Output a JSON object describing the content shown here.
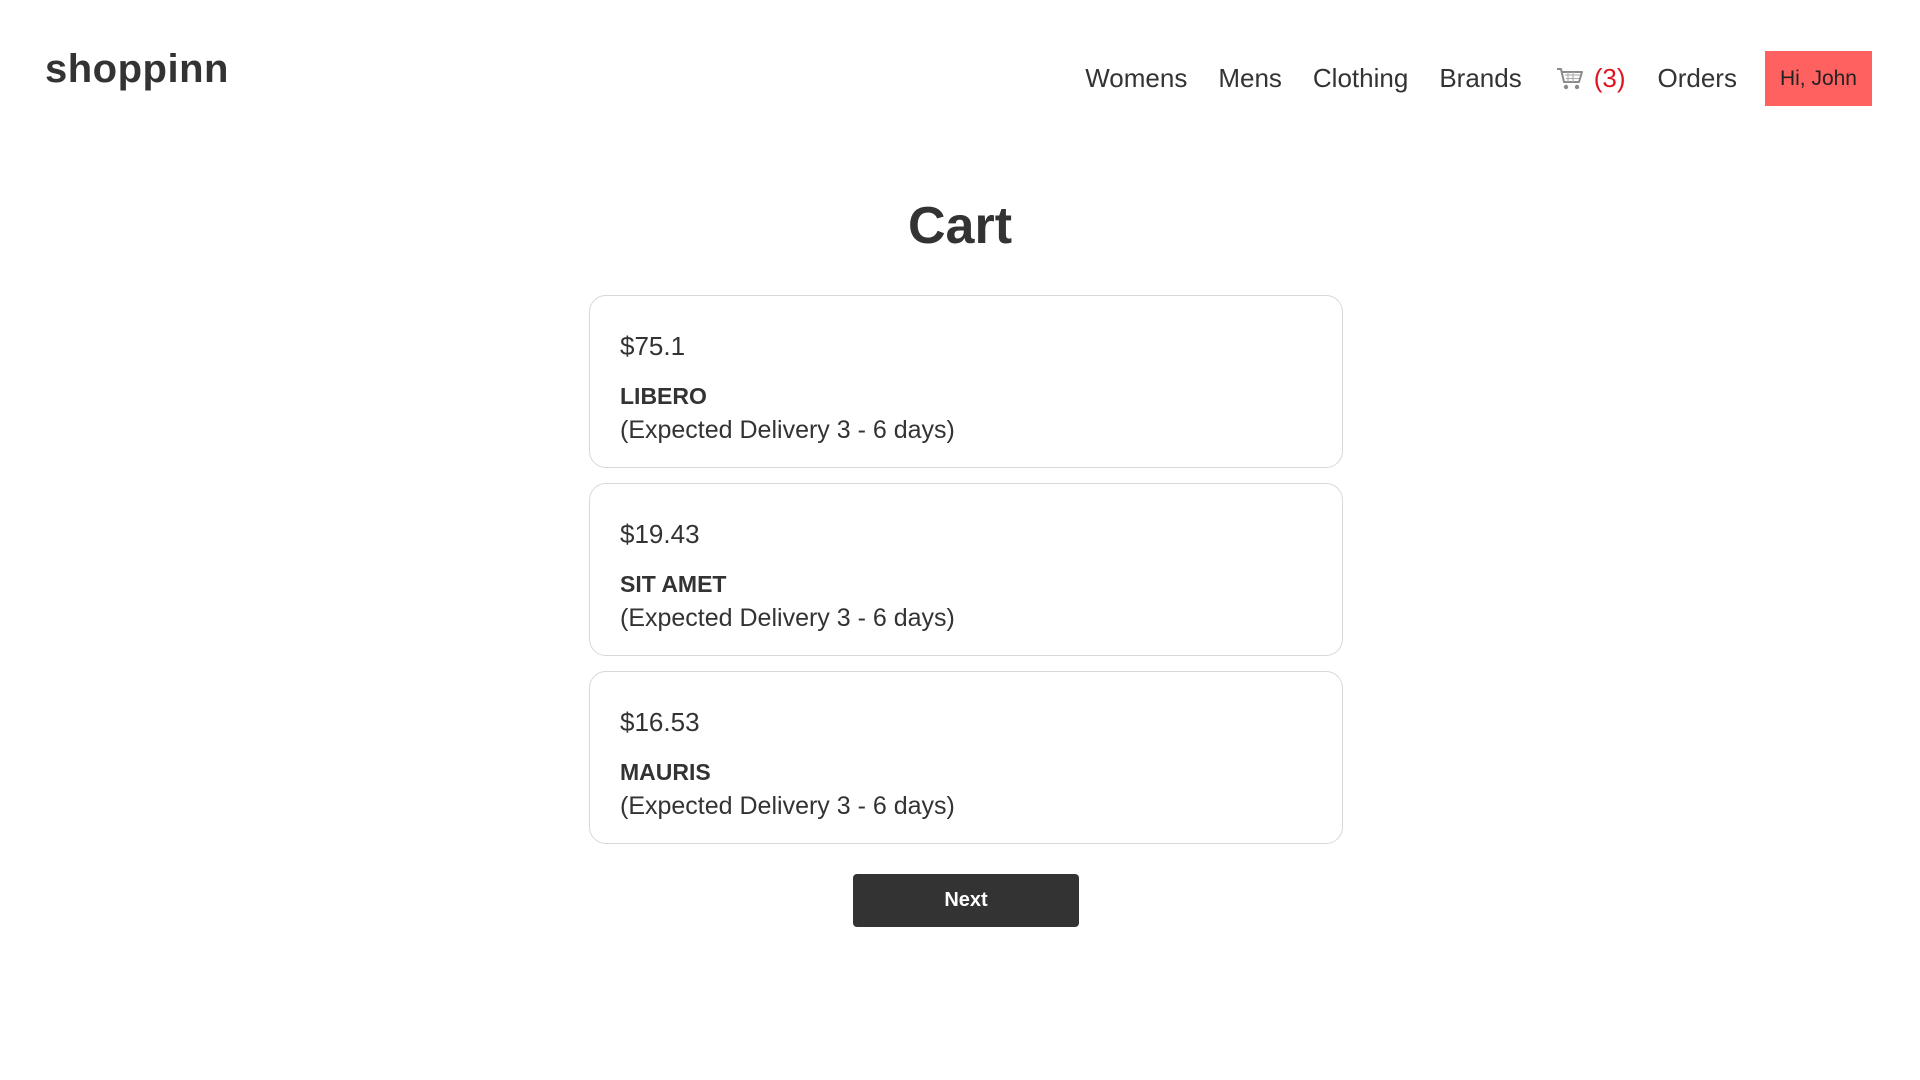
{
  "header": {
    "logo": "shoppinn",
    "nav": [
      "Womens",
      "Mens",
      "Clothing",
      "Brands"
    ],
    "cart_icon": "cart-icon",
    "cart_count": "(3)",
    "orders": "Orders",
    "greeting": "Hi, John"
  },
  "page": {
    "title": "Cart"
  },
  "cart": {
    "items": [
      {
        "price": "$75.1",
        "name": "LIBERO",
        "delivery": "(Expected Delivery 3 - 6 days)"
      },
      {
        "price": "$19.43",
        "name": "SIT AMET",
        "delivery": "(Expected Delivery 3 - 6 days)"
      },
      {
        "price": "$16.53",
        "name": "MAURIS",
        "delivery": "(Expected Delivery 3 - 6 days)"
      }
    ]
  },
  "actions": {
    "next": "Next"
  },
  "colors": {
    "accent": "#ff6161",
    "cart_count": "#e0141e",
    "button_dark": "#333333",
    "text": "#333333"
  }
}
